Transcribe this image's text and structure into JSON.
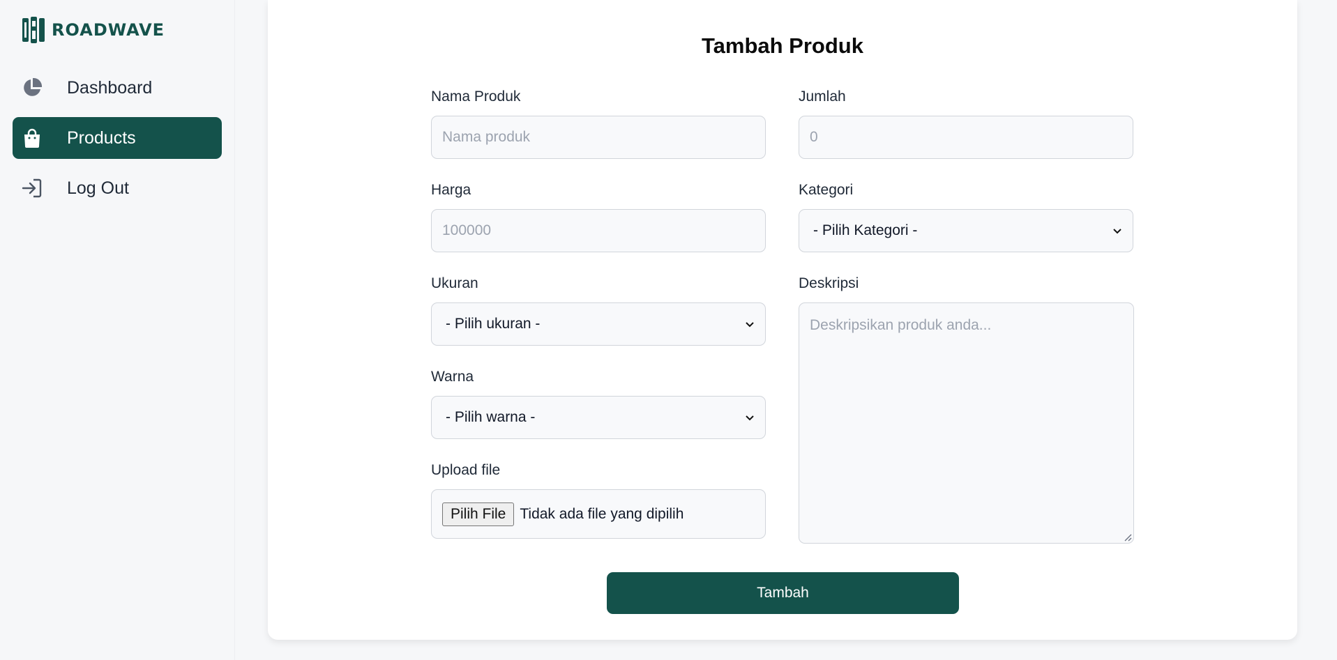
{
  "brand": {
    "name": "ROADWAVE",
    "color": "#14524b"
  },
  "sidebar": {
    "items": [
      {
        "label": "Dashboard",
        "icon": "pie-chart-icon",
        "active": false
      },
      {
        "label": "Products",
        "icon": "shopping-bag-icon",
        "active": true
      },
      {
        "label": "Log Out",
        "icon": "logout-icon",
        "active": false
      }
    ]
  },
  "form": {
    "title": "Tambah Produk",
    "nama_produk": {
      "label": "Nama Produk",
      "placeholder": "Nama produk",
      "value": ""
    },
    "jumlah": {
      "label": "Jumlah",
      "placeholder": "0",
      "value": ""
    },
    "harga": {
      "label": "Harga",
      "placeholder": "100000",
      "value": ""
    },
    "kategori": {
      "label": "Kategori",
      "selected": "- Pilih Kategori -"
    },
    "ukuran": {
      "label": "Ukuran",
      "selected": "- Pilih ukuran -"
    },
    "deskripsi": {
      "label": "Deskripsi",
      "placeholder": "Deskripsikan produk anda..."
    },
    "warna": {
      "label": "Warna",
      "selected": "- Pilih warna -"
    },
    "upload": {
      "label": "Upload file",
      "button": "Pilih File",
      "status": "Tidak ada file yang dipilih"
    },
    "submit_label": "Tambah"
  }
}
